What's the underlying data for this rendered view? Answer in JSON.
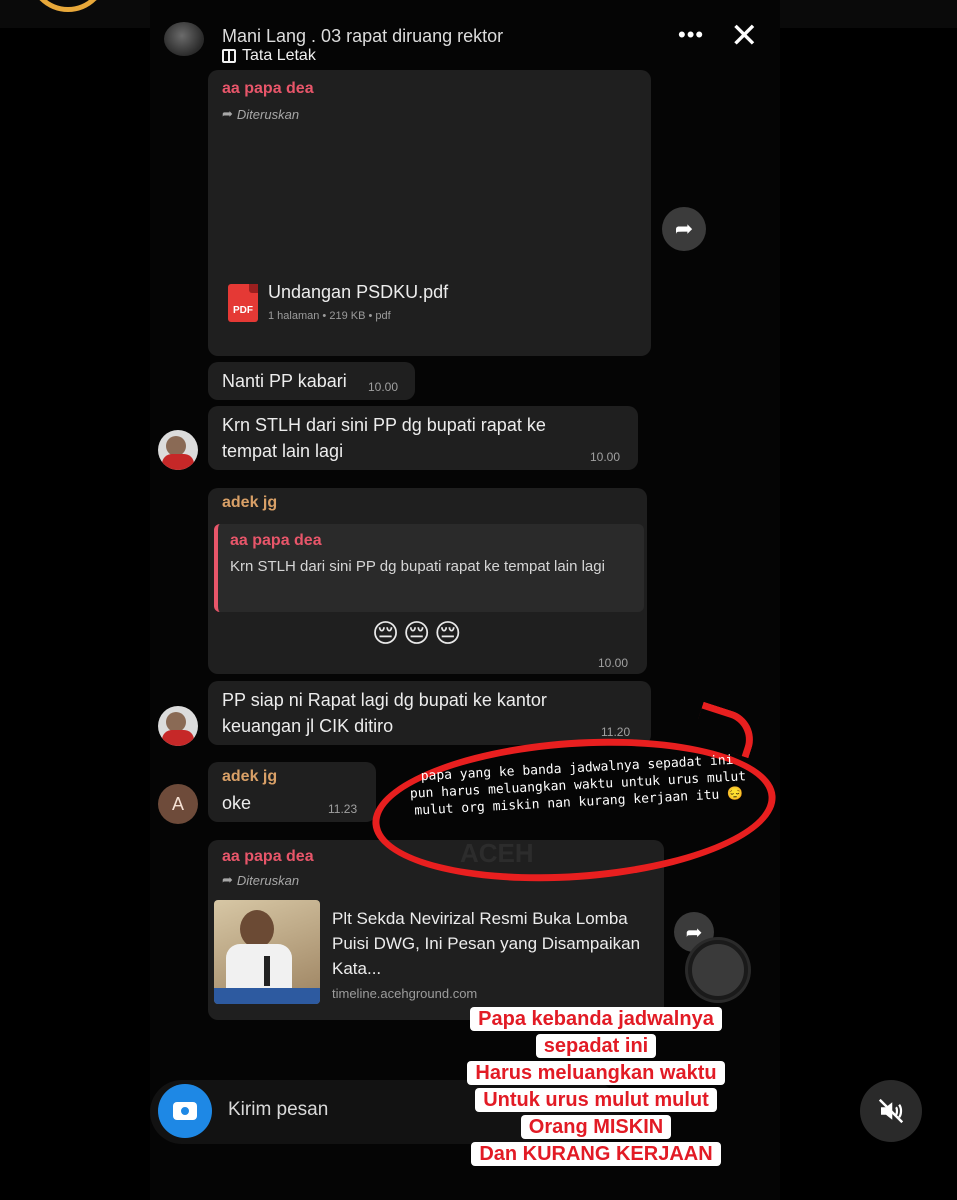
{
  "header": {
    "title": "Mani Lang . 03 rapat diruang rektor",
    "layout_label": "Tata Letak",
    "more_icon": "more-dots-icon",
    "close_icon": "close-icon"
  },
  "messages": {
    "m1": {
      "sender": "aa papa dea",
      "forwarded": "Diteruskan",
      "file_name": "Undangan PSDKU.pdf",
      "file_meta": "1 halaman • 219 KB • pdf",
      "file_icon_label": "PDF"
    },
    "m2": {
      "text": "Nanti PP kabari",
      "time": "10.00"
    },
    "m3": {
      "text": "Krn STLH dari sini PP dg bupati rapat ke tempat lain lagi",
      "time": "10.00"
    },
    "m4": {
      "sender": "adek jg",
      "quote_sender": "aa papa dea",
      "quote_text": "Krn STLH dari sini PP dg bupati rapat ke tempat lain lagi",
      "emojis": "😔😔😔",
      "time": "10.00"
    },
    "m5": {
      "text": "PP siap ni Rapat lagi dg bupati ke kantor keuangan jl CIK ditiro",
      "time": "11.20"
    },
    "m6": {
      "sender": "adek jg",
      "text": "oke",
      "time": "11.23",
      "avatar_letter": "A"
    },
    "m7": {
      "sender": "aa papa dea",
      "forwarded": "Diteruskan",
      "link_title": "Plt Sekda Nevirizal Resmi Buka Lomba Puisi DWG, Ini Pesan yang Disampaikan Kata...",
      "link_domain": "timeline.acehground.com"
    }
  },
  "annotation": {
    "text": "papa yang ke banda jadwalnya sepadat ini pun harus meluangkan waktu untuk urus mulut mulut org miskin nan kurang kerjaan itu 😔",
    "color": "#e81f1f"
  },
  "watermark": "ACEH",
  "input": {
    "placeholder": "Kirim pesan"
  },
  "caption": {
    "lines": [
      "Papa kebanda jadwalnya",
      "sepadat ini",
      "Harus meluangkan waktu",
      "Untuk urus mulut mulut",
      "Orang MISKIN",
      "Dan KURANG KERJAAN"
    ],
    "color": "#e21b25"
  },
  "colors": {
    "sender_red": "#e8566a",
    "sender_gold": "#d9a067",
    "camera_blue": "#1e88e5"
  }
}
